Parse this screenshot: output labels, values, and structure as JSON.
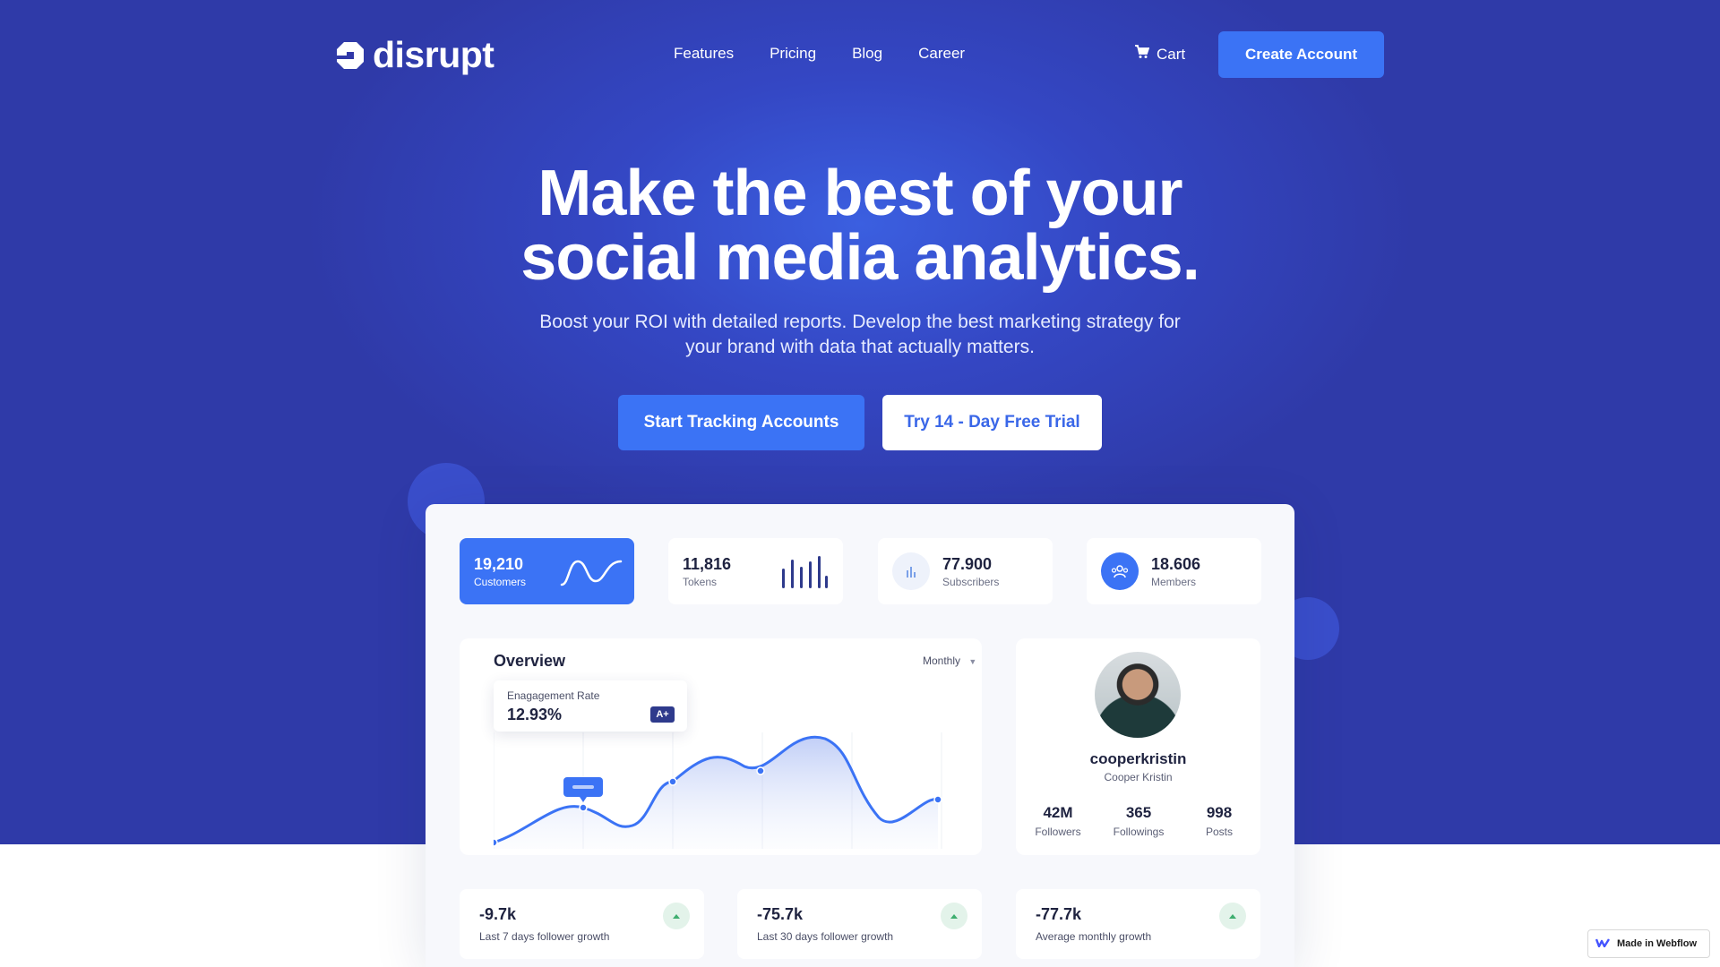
{
  "header": {
    "logo_text": "disrupt",
    "nav": [
      "Features",
      "Pricing",
      "Blog",
      "Career"
    ],
    "cart_label": "Cart",
    "create_account_label": "Create Account"
  },
  "hero": {
    "headline_line1": "Make the best of your",
    "headline_line2": "social media analytics.",
    "subtext_line1": "Boost your ROI with detailed reports. Develop the best marketing strategy for",
    "subtext_line2": "your brand with data that actually matters.",
    "primary_cta": "Start Tracking Accounts",
    "secondary_cta": "Try 14 - Day Free Trial"
  },
  "dashboard": {
    "stats": [
      {
        "value": "19,210",
        "label": "Customers"
      },
      {
        "value": "11,816",
        "label": "Tokens"
      },
      {
        "value": "77.900",
        "label": "Subscribers"
      },
      {
        "value": "18.606",
        "label": "Members"
      }
    ],
    "overview": {
      "title": "Overview",
      "period": "Monthly",
      "engagement_label": "Enagagement Rate",
      "engagement_value": "12.93%",
      "engagement_badge": "A+"
    },
    "profile": {
      "username": "cooperkristin",
      "name": "Cooper Kristin",
      "stats": [
        {
          "value": "42M",
          "label": "Followers"
        },
        {
          "value": "365",
          "label": "Followings"
        },
        {
          "value": "998",
          "label": "Posts"
        }
      ]
    },
    "growth": [
      {
        "value": "-9.7k",
        "label": "Last 7 days follower growth"
      },
      {
        "value": "-75.7k",
        "label": "Last 30 days follower growth"
      },
      {
        "value": "-77.7k",
        "label": "Average monthly growth"
      }
    ]
  },
  "badge": {
    "label": "Made in Webflow"
  },
  "colors": {
    "hero_bg": "#3038a8",
    "accent": "#3b73f5",
    "badge_dark": "#2e3a8c"
  }
}
